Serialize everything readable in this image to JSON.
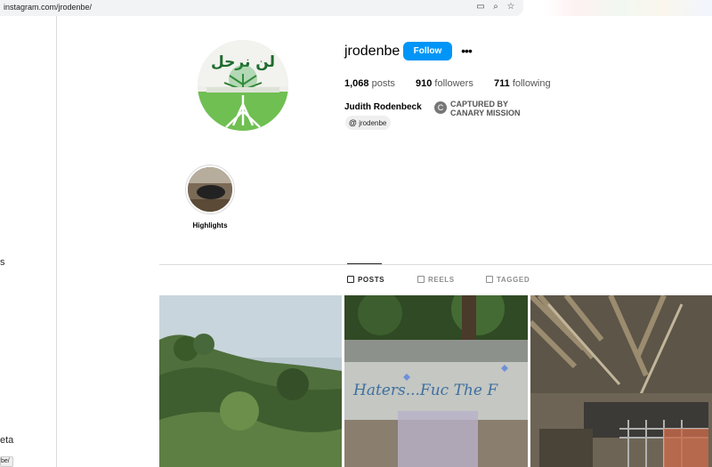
{
  "browser": {
    "url": "instagram.com/jrodenbe/",
    "icons": [
      "install-app-icon",
      "zoom-icon",
      "bookmark-star-icon"
    ]
  },
  "left_nav": {
    "partial_label_1": "s",
    "partial_label_2": "eta",
    "partial_pill": "be/"
  },
  "profile": {
    "username": "jrodenbe",
    "follow_label": "Follow",
    "more_label": "•••",
    "stats": [
      {
        "value": "1,068",
        "label": "posts"
      },
      {
        "value": "910",
        "label": "followers"
      },
      {
        "value": "711",
        "label": "following"
      }
    ],
    "full_name": "Judith Rodenbeck",
    "threads_handle": "jrodenbe",
    "captured_line1": "CAPTURED BY",
    "captured_line2": "CANARY MISSION",
    "avatar_arabic_text": "لن نرحل"
  },
  "highlights": [
    {
      "label": "Highlights"
    }
  ],
  "tabs": [
    {
      "label": "POSTS",
      "active": true
    },
    {
      "label": "REELS",
      "active": false
    },
    {
      "label": "TAGGED",
      "active": false
    }
  ],
  "posts": [
    {
      "alt": "green hillside"
    },
    {
      "alt": "graffiti wall",
      "text": "Haters...Fuc The F"
    },
    {
      "alt": "debris and branches"
    }
  ],
  "colors": {
    "accent": "#0095f6",
    "border": "#dbdbdb"
  }
}
